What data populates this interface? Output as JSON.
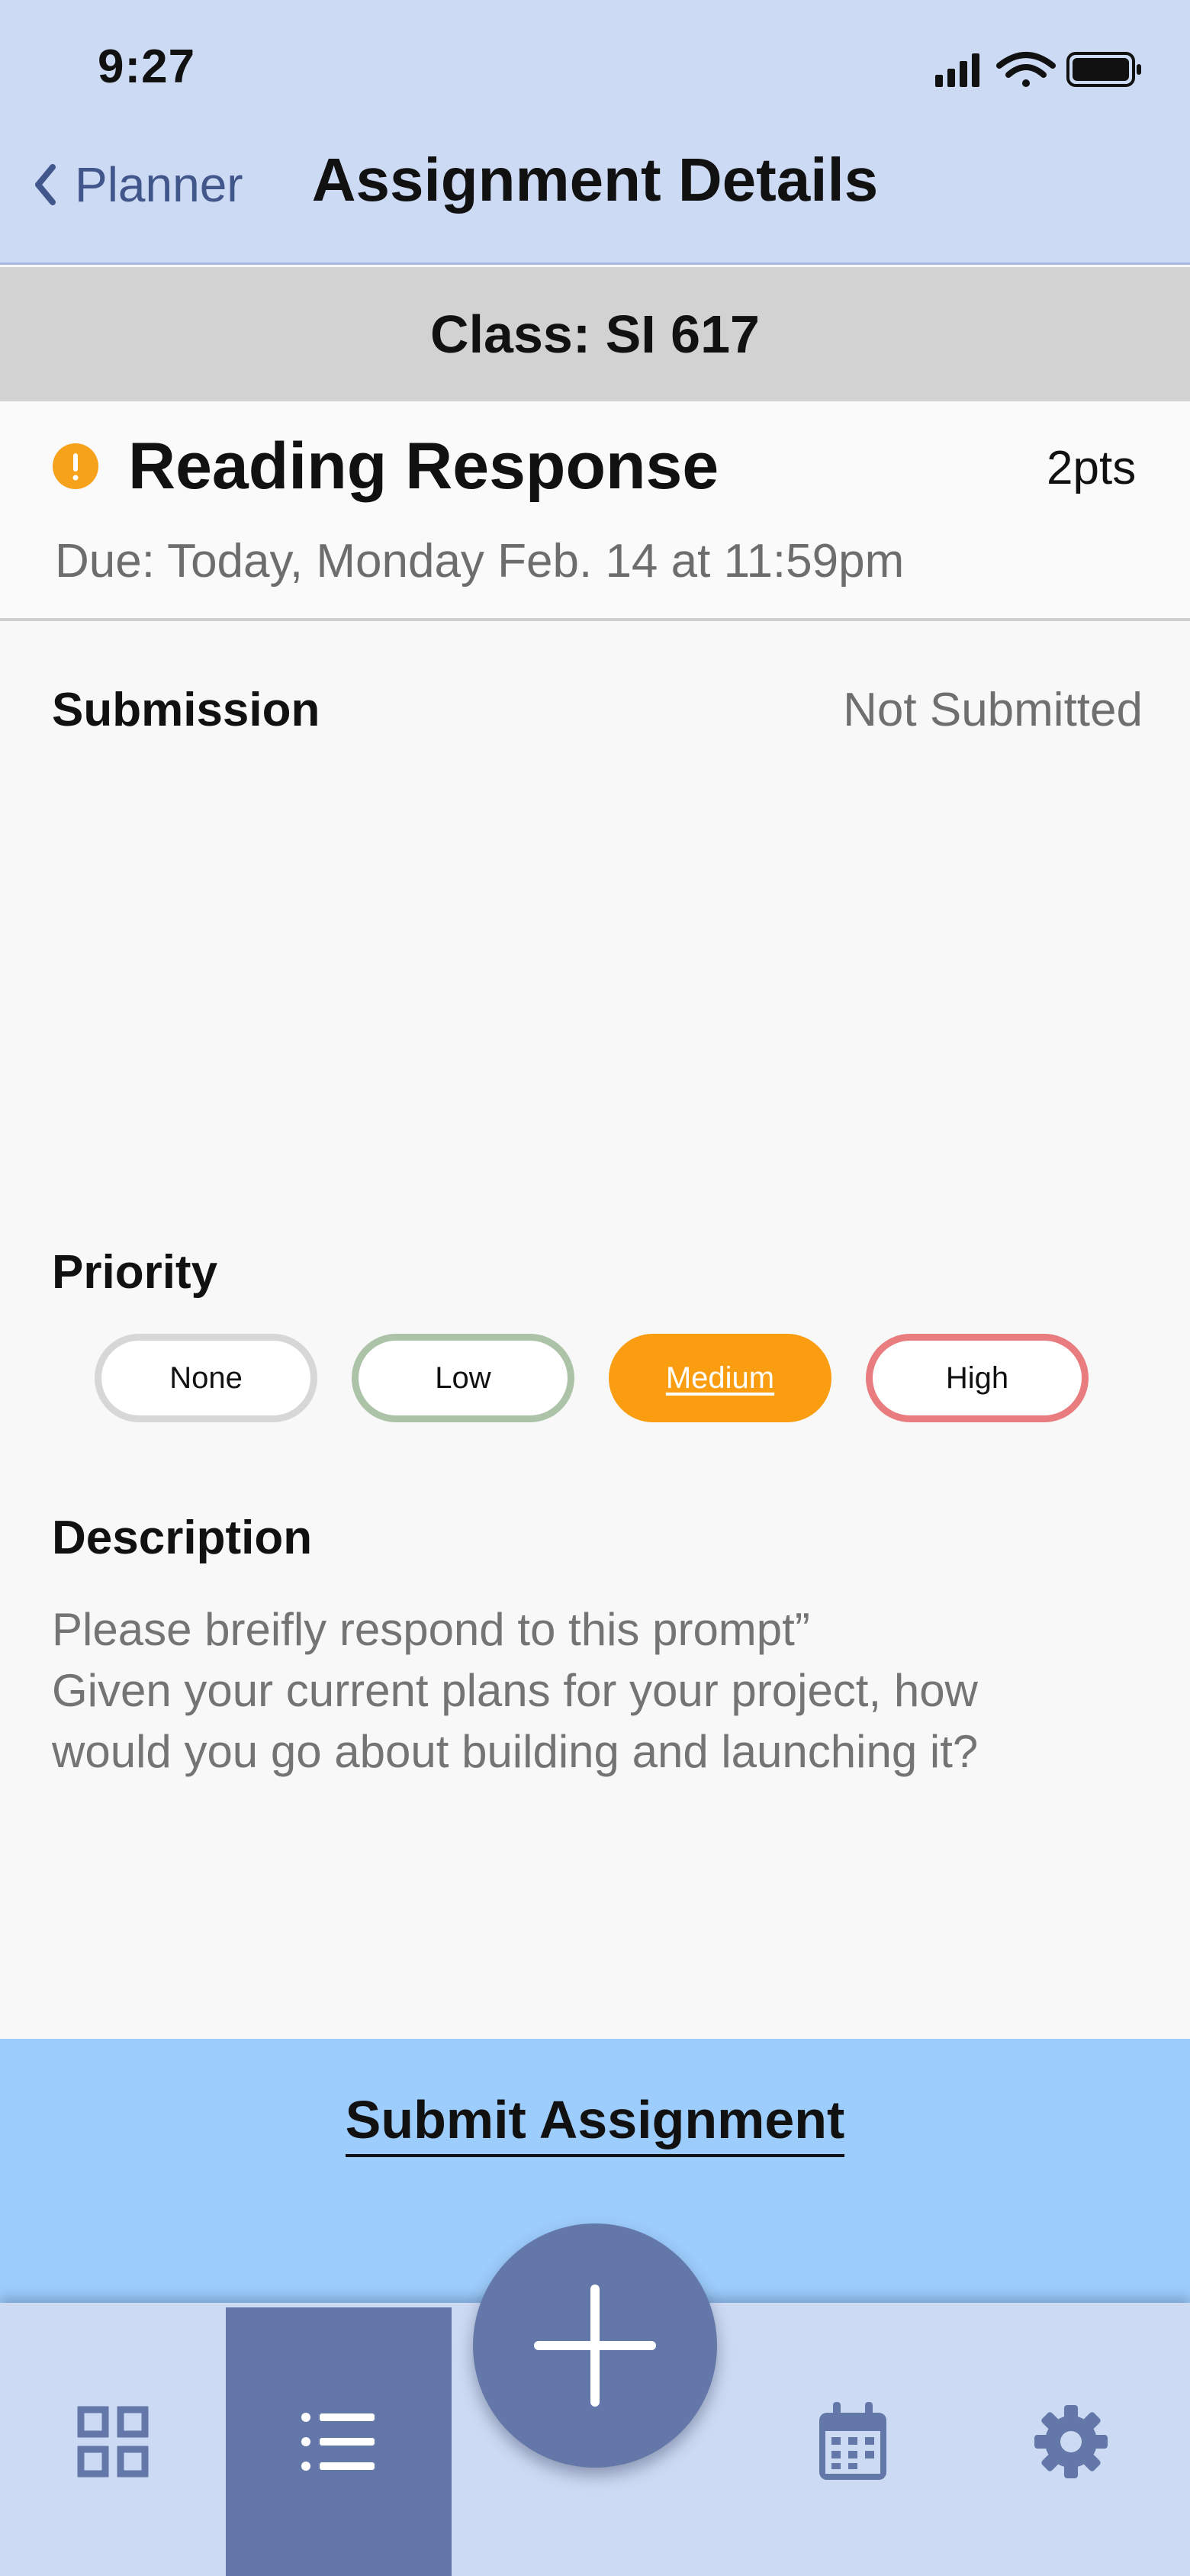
{
  "status_bar": {
    "time": "9:27"
  },
  "nav": {
    "back_label": "Planner",
    "title": "Assignment Details"
  },
  "class_strip": {
    "label": "Class: SI 617"
  },
  "assignment": {
    "title": "Reading Response",
    "points": "2pts",
    "due": "Due: Today, Monday Feb. 14 at 11:59pm"
  },
  "submission": {
    "label": "Submission",
    "status": "Not Submitted"
  },
  "priority": {
    "label": "Priority",
    "options": [
      "None",
      "Low",
      "Medium",
      "High"
    ],
    "selected": "Medium"
  },
  "description": {
    "label": "Description",
    "text": "Please breifly respond to this prompt”\nGiven your current plans for your project, how\nwould you go about building and launching it?"
  },
  "submit": {
    "label": "Submit Assignment"
  },
  "tabbar": {
    "active_tab": "list",
    "icons": [
      "grid-icon",
      "list-icon",
      "plus-icon",
      "calendar-icon",
      "gear-icon"
    ]
  },
  "colors": {
    "header_bg": "#cddaf4",
    "accent_dark": "#6378a9",
    "submit_bg": "#9dcdfc",
    "priority_medium": "#fa9d10",
    "priority_low": "#adc3a8",
    "priority_high": "#e87c7f",
    "alert": "#f6a21a"
  }
}
